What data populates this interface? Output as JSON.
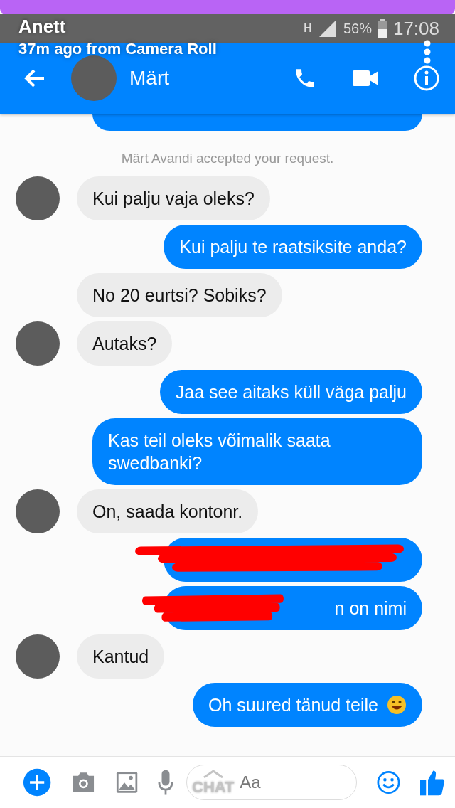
{
  "snap": {
    "sender": "Anett",
    "subtitle": "37m ago from Camera Roll",
    "chat_label": "CHAT"
  },
  "status_bar": {
    "network": "H",
    "battery": "56%",
    "time": "17:08"
  },
  "header": {
    "contact": "Märt"
  },
  "messages": [
    {
      "kind": "cut"
    },
    {
      "kind": "notice",
      "text": "Märt Avandi accepted your request."
    },
    {
      "kind": "received",
      "text": "Kui palju vaja oleks?",
      "avatar": true
    },
    {
      "kind": "sent",
      "text": "Kui palju te raatsiksite anda?"
    },
    {
      "kind": "received",
      "text": "No 20 eurtsi? Sobiks?",
      "avatar": false
    },
    {
      "kind": "received",
      "text": "Autaks?",
      "avatar": true
    },
    {
      "kind": "sent",
      "text": "Jaa see aitaks küll väga palju"
    },
    {
      "kind": "sent",
      "text": "Kas teil oleks võimalik saata swedbanki?"
    },
    {
      "kind": "received",
      "text": "On, saada kontonr.",
      "avatar": true
    },
    {
      "kind": "sent",
      "redacted": true
    },
    {
      "kind": "sent",
      "text": "n on nimi",
      "redacted": true
    },
    {
      "kind": "received",
      "text": "Kantud",
      "avatar": true
    },
    {
      "kind": "sent",
      "text": "Oh suured tänud teile",
      "emoji": true
    }
  ],
  "composer": {
    "placeholder": "Aa"
  }
}
